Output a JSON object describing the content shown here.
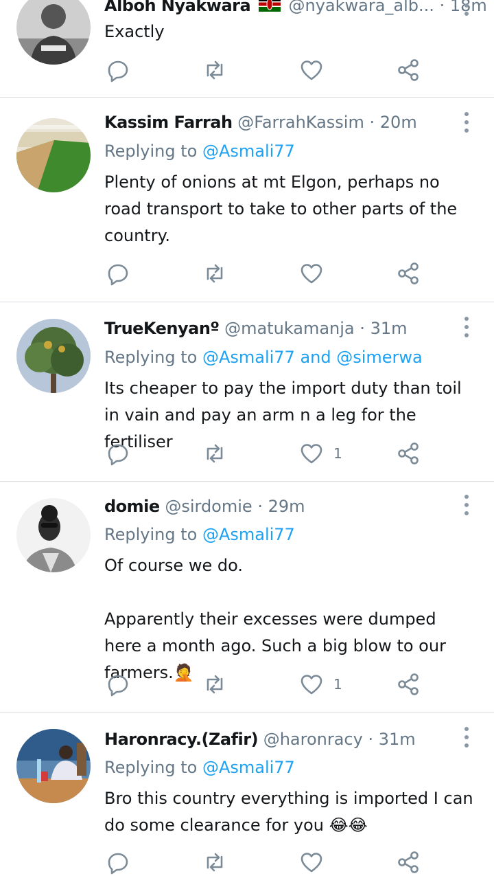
{
  "colors": {
    "link": "#1da1f2",
    "muted": "#657786",
    "icon": "#7b8a97",
    "divider": "#d7dbdf"
  },
  "tweets": [
    {
      "name": "Alboh Nyakwara",
      "flag_icon": "kenya-flag-icon",
      "handle": "@nyakwara_alb...",
      "time": "18m",
      "text_lines": [
        "Exactly"
      ],
      "likes": ""
    },
    {
      "name": "Kassim Farrah",
      "handle": "@FarrahKassim",
      "time": "20m",
      "replying_prefix": "Replying to ",
      "replying_to": "@Asmali77",
      "text_lines": [
        "Plenty of onions at mt Elgon, perhaps no road transport to take to other parts of the country."
      ],
      "likes": ""
    },
    {
      "name": "TrueKenyanº",
      "handle": "@matukamanja",
      "time": "31m",
      "replying_prefix": "Replying to ",
      "replying_to": "@Asmali77 and @simerwa",
      "text_lines": [
        "Its cheaper to pay the import duty than toil in vain and pay an arm n a leg for the fertiliser"
      ],
      "likes": "1"
    },
    {
      "name": "domie",
      "handle": "@sirdomie",
      "time": "29m",
      "replying_prefix": "Replying to ",
      "replying_to": "@Asmali77",
      "text_lines": [
        "Of course we do.",
        "",
        "Apparently their excesses were dumped here a month ago. Such a big blow to our farmers.🤦"
      ],
      "likes": "1"
    },
    {
      "name": "Haronracy.(Zafir)",
      "handle": "@haronracy",
      "time": "31m",
      "replying_prefix": "Replying to ",
      "replying_to": "@Asmali77",
      "text_lines": [
        "Bro this country  everything is imported I can do some clearance for you 😂😂"
      ],
      "likes": ""
    }
  ],
  "separator_dot": "·"
}
